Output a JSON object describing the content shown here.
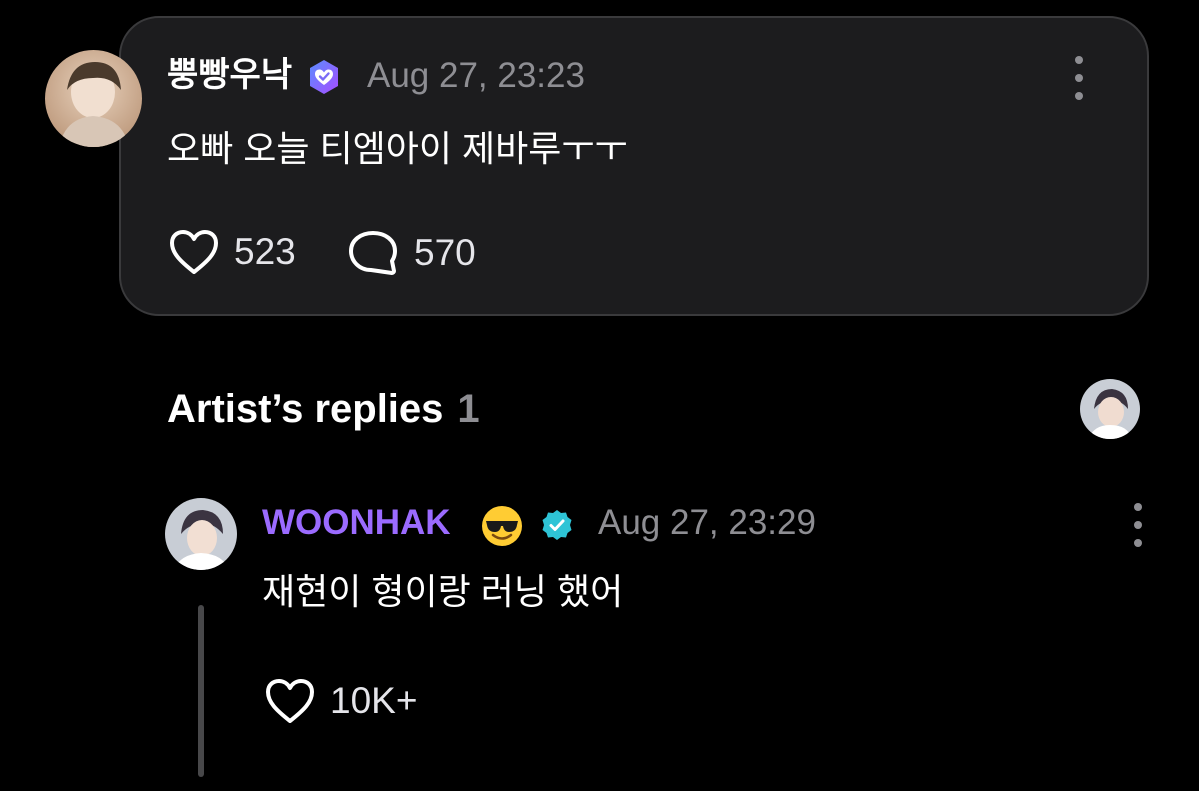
{
  "post": {
    "username": "뿡빵우낙",
    "timestamp": "Aug 27, 23:23",
    "text": "오빠 오늘 티엠아이 제바루ㅜㅜ",
    "likes": "523",
    "comments": "570",
    "badge_color": "#7b6cf6"
  },
  "artist_replies": {
    "title": "Artist’s replies",
    "count": "1"
  },
  "reply": {
    "username": "WOONHAK",
    "emoji": "😎",
    "timestamp": "Aug 27, 23:29",
    "text": "재현이 형이랑 러닝 했어",
    "likes": "10K+",
    "username_color": "#9b6bff",
    "badge_color": "#2ec4d6"
  },
  "icons": {
    "post_badge": "verified-heart-badge-icon",
    "reply_badge": "verified-check-badge-icon",
    "like": "heart-icon",
    "comment": "speech-bubble-icon",
    "more": "more-vertical-icon"
  }
}
